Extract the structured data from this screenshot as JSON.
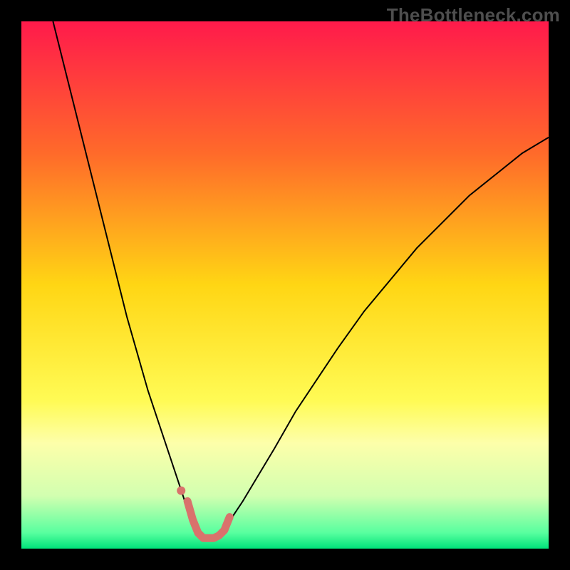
{
  "watermark": "TheBottleneck.com",
  "chart_data": {
    "type": "line",
    "title": "",
    "xlabel": "",
    "ylabel": "",
    "xlim": [
      0,
      100
    ],
    "ylim": [
      0,
      100
    ],
    "grid": false,
    "legend": false,
    "background_gradient": {
      "stops": [
        {
          "offset": 0.0,
          "color": "#ff1a4b"
        },
        {
          "offset": 0.25,
          "color": "#ff6a2a"
        },
        {
          "offset": 0.5,
          "color": "#ffd614"
        },
        {
          "offset": 0.72,
          "color": "#fffb55"
        },
        {
          "offset": 0.8,
          "color": "#fdffaa"
        },
        {
          "offset": 0.9,
          "color": "#d2ffb0"
        },
        {
          "offset": 0.97,
          "color": "#58ff9f"
        },
        {
          "offset": 1.0,
          "color": "#00e37a"
        }
      ]
    },
    "series": [
      {
        "name": "bottleneck-curve",
        "stroke": "#000000",
        "stroke_width": 2,
        "x": [
          6,
          8,
          10,
          12,
          14,
          16,
          18,
          20,
          22,
          24,
          26,
          28,
          30,
          31,
          32,
          33,
          34,
          35,
          36,
          37,
          38,
          40,
          42,
          45,
          48,
          52,
          56,
          60,
          65,
          70,
          75,
          80,
          85,
          90,
          95,
          100
        ],
        "y": [
          100,
          92,
          84,
          76,
          68,
          60,
          52,
          44,
          37,
          30,
          24,
          18,
          12,
          9,
          6,
          4,
          2.5,
          2,
          2,
          2.5,
          3.5,
          6,
          9,
          14,
          19,
          26,
          32,
          38,
          45,
          51,
          57,
          62,
          67,
          71,
          75,
          78
        ]
      },
      {
        "name": "sweet-spot-marker",
        "stroke": "#d9726c",
        "stroke_width": 11,
        "linecap": "round",
        "x": [
          31.5,
          32.5,
          33.5,
          34.5,
          35.5,
          36.5,
          37.5,
          38.5,
          39.5
        ],
        "y": [
          9,
          5.5,
          3,
          2,
          2,
          2,
          2.5,
          3.5,
          6
        ]
      }
    ],
    "annotations": [
      {
        "type": "dot",
        "x": 30.3,
        "y": 11,
        "r": 6,
        "fill": "#d9726c"
      }
    ]
  }
}
